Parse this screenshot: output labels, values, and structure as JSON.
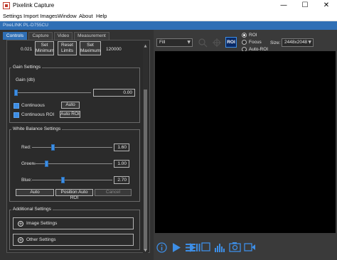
{
  "window": {
    "title": "Pixelink Capture",
    "minimize": "—",
    "maximize": "☐",
    "close": "✕"
  },
  "menu": [
    "Settings",
    "Import Images",
    "Window",
    "About",
    "Help"
  ],
  "device_label": "PixeLINK PL-D755CU",
  "tabs": [
    "Controls",
    "Capture",
    "Video",
    "Measurement"
  ],
  "exposure": {
    "value": "0.021",
    "set_min_label": "Set\nMinimum",
    "reset_label": "Reset\nLimits",
    "set_max_label": "Set\nMaximum",
    "max_value": "120000"
  },
  "gain": {
    "group_title": "Gain Settings",
    "label": "Gain (db)",
    "value": "0.00",
    "slider_level": 0,
    "continuous_label": "Continuous",
    "continuous_roi_label": "Continuous ROI",
    "auto_label": "Auto",
    "auto_roi_label": "Auto ROI"
  },
  "white_balance": {
    "group_title": "White Balance Settings",
    "red_label": "Red:",
    "red_value": "1.60",
    "green_label": "Green:",
    "green_value": "1.00",
    "blue_label": "Blue:",
    "blue_value": "2.70",
    "auto_label": "Auto",
    "position_auto_roi_label": "Position Auto ROI",
    "cancel_label": "Cancel"
  },
  "additional": {
    "group_title": "Additional Settings",
    "image_settings_label": "Image Settings",
    "other_settings_label": "Other Settings"
  },
  "preview_controls": {
    "view_mode": "Fill",
    "roi_button_label": "ROI",
    "radio_options": [
      "ROI",
      "Focus",
      "Auto-ROI"
    ],
    "selected_option": "ROI",
    "size_label": "Size:",
    "size_value": "2448x2048"
  },
  "bottom_icons": [
    "info-icon",
    "play-icon",
    "list-icon",
    "play-pause-icon",
    "stop-icon",
    "histogram-icon",
    "camera-icon",
    "video-icon"
  ],
  "colors": {
    "accent": "#3d8ee6",
    "device_bar": "#2f6fb5",
    "background": "#2b2b2b"
  }
}
